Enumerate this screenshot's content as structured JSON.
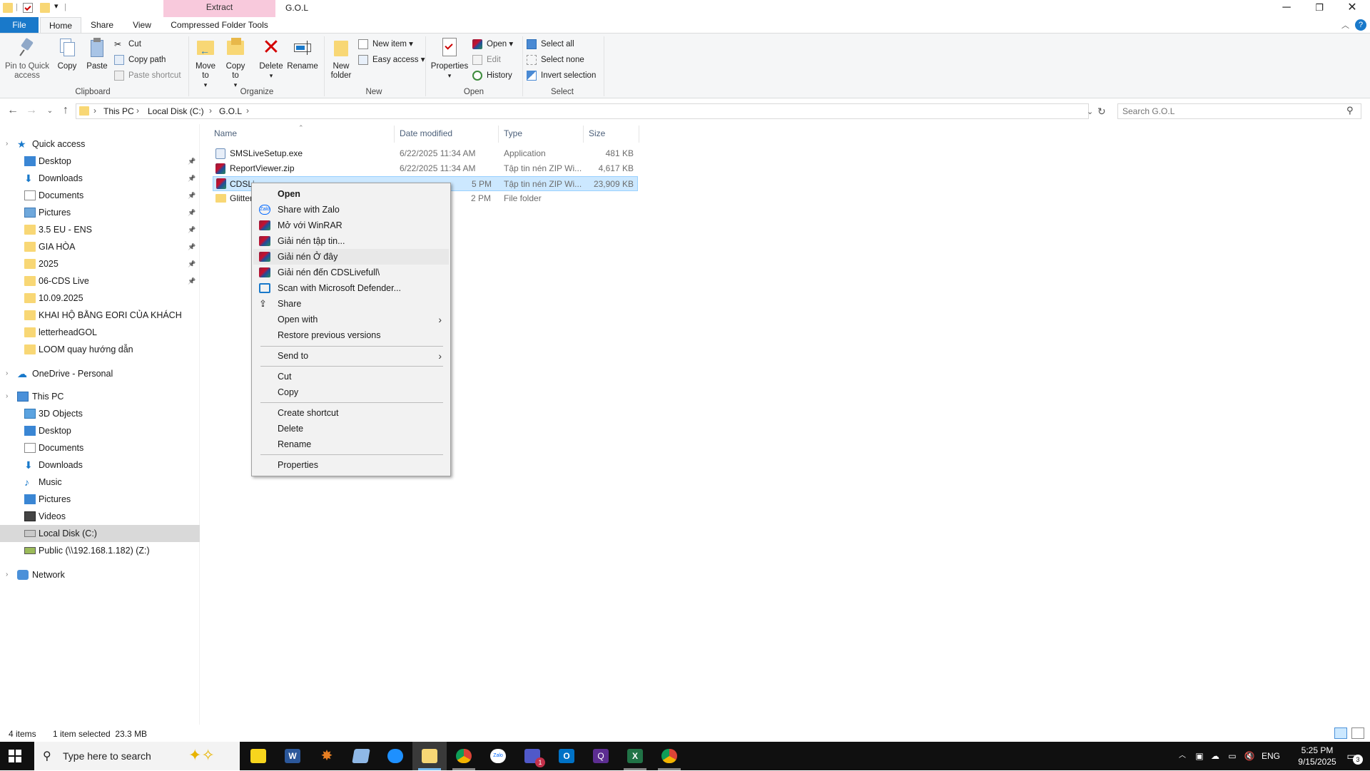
{
  "window": {
    "title": "G.O.L",
    "context_tab_header": "Extract",
    "controls": {
      "minimize": "─",
      "restore": "❐",
      "close": "✕"
    }
  },
  "ribbon_tabs": [
    "File",
    "Home",
    "Share",
    "View",
    "Compressed Folder Tools"
  ],
  "ribbon": {
    "clipboard": {
      "label": "Clipboard",
      "pin": "Pin to Quick access",
      "copy": "Copy",
      "paste": "Paste",
      "cut": "Cut",
      "copy_path": "Copy path",
      "paste_shortcut": "Paste shortcut"
    },
    "organize": {
      "label": "Organize",
      "move_to": "Move to",
      "copy_to": "Copy to",
      "delete": "Delete",
      "rename": "Rename"
    },
    "new": {
      "label": "New",
      "new_folder": "New folder",
      "new_item": "New item",
      "easy_access": "Easy access"
    },
    "open": {
      "label": "Open",
      "properties": "Properties",
      "open": "Open",
      "edit": "Edit",
      "history": "History"
    },
    "select": {
      "label": "Select",
      "select_all": "Select all",
      "select_none": "Select none",
      "invert": "Invert selection"
    }
  },
  "address": {
    "crumbs": [
      "This PC",
      "Local Disk (C:)",
      "G.O.L"
    ],
    "search_placeholder": "Search G.O.L"
  },
  "nav_pane": {
    "quick_access": "Quick access",
    "quick_items": [
      {
        "label": "Desktop",
        "pinned": true
      },
      {
        "label": "Downloads",
        "pinned": true
      },
      {
        "label": "Documents",
        "pinned": true
      },
      {
        "label": "Pictures",
        "pinned": true
      },
      {
        "label": "3.5 EU - ENS",
        "pinned": true
      },
      {
        "label": "GIA HÒA",
        "pinned": true
      },
      {
        "label": "2025",
        "pinned": true
      },
      {
        "label": "06-CDS Live",
        "pinned": true
      },
      {
        "label": "10.09.2025",
        "pinned": false
      },
      {
        "label": "KHAI HỘ BẰNG EORI CỦA KHÁCH",
        "pinned": false
      },
      {
        "label": "letterheadGOL",
        "pinned": false
      },
      {
        "label": "LOOM quay hướng dẫn",
        "pinned": false
      }
    ],
    "onedrive": "OneDrive - Personal",
    "this_pc": "This PC",
    "pc_items": [
      "3D Objects",
      "Desktop",
      "Documents",
      "Downloads",
      "Music",
      "Pictures",
      "Videos",
      "Local Disk (C:)",
      "Public (\\\\192.168.1.182) (Z:)"
    ],
    "network": "Network",
    "pin_glyph": "📌"
  },
  "file_list": {
    "columns": [
      "Name",
      "Date modified",
      "Type",
      "Size"
    ],
    "rows": [
      {
        "name": "SMSLiveSetup.exe",
        "date": "6/22/2025 11:34 AM",
        "type": "Application",
        "size": "481 KB"
      },
      {
        "name": "ReportViewer.zip",
        "date": "6/22/2025 11:34 AM",
        "type": "Tập tin nén ZIP Wi...",
        "size": "4,617 KB"
      },
      {
        "name": "CDSLi",
        "date": "",
        "date_tail": "5 PM",
        "type": "Tập tin nén ZIP Wi...",
        "size": "23,909 KB"
      },
      {
        "name": "Glitter",
        "date": "",
        "date_tail": "2 PM",
        "type": "File folder",
        "size": ""
      }
    ]
  },
  "context_menu": {
    "items": [
      "Open",
      "Share with Zalo",
      "Mở với WinRAR",
      "Giải nén tập tin...",
      "Giải nén Ở đây",
      "Giải nén đến CDSLivefull\\",
      "Scan with Microsoft Defender...",
      "Share",
      "Open with",
      "Restore previous versions",
      "Send to",
      "Cut",
      "Copy",
      "Create shortcut",
      "Delete",
      "Rename",
      "Properties"
    ],
    "hovered": "Giải nén Ở đây"
  },
  "status": {
    "items": "4 items",
    "selected": "1 item selected  23.3 MB"
  },
  "taskbar": {
    "search_placeholder": "Type here to search",
    "language": "ENG",
    "time": "5:25 PM",
    "date": "9/15/2025",
    "teams_badge": "1",
    "notif_badge": "3"
  },
  "colors": {
    "file_tab": "#1979ca",
    "selection": "#cce8ff",
    "extract_tab": "#f8c9dc"
  }
}
